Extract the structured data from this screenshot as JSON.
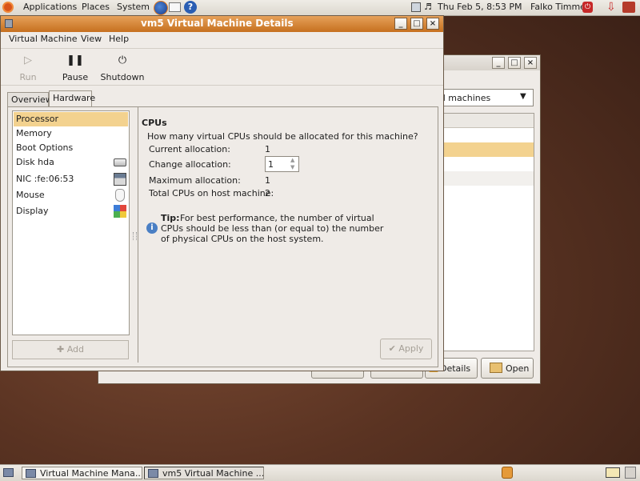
{
  "top_panel": {
    "menu": [
      "Applications",
      "Places",
      "System"
    ],
    "clock": "Thu Feb  5,  8:53 PM",
    "user": "Falko Timme"
  },
  "main_window": {
    "title": "vm5 Virtual Machine Details",
    "menu": {
      "machine": "Virtual Machine",
      "view": "View",
      "help": "Help"
    },
    "toolbar": {
      "run": "Run",
      "pause": "Pause",
      "shutdown": "Shutdown"
    },
    "tabs": [
      "Overview",
      "Hardware"
    ],
    "hardware_items": [
      {
        "label": "Processor",
        "icon": "cpu-icon"
      },
      {
        "label": "Memory",
        "icon": "memory-icon"
      },
      {
        "label": "Boot Options",
        "icon": "boot-icon"
      },
      {
        "label": "Disk hda",
        "icon": "disk-icon"
      },
      {
        "label": "NIC :fe:06:53",
        "icon": "network-icon"
      },
      {
        "label": "Mouse",
        "icon": "mouse-icon"
      },
      {
        "label": "Display",
        "icon": "display-icon"
      }
    ],
    "add_button": "Add",
    "cpu": {
      "heading": "CPUs",
      "question": "How many virtual CPUs should be allocated for this machine?",
      "current_label": "Current allocation:",
      "current_value": "1",
      "change_label": "Change allocation:",
      "change_value": "1",
      "max_label": "Maximum allocation:",
      "max_value": "1",
      "total_label": "Total CPUs on host machine:",
      "total_value": "2",
      "tip_label": "Tip:",
      "tip_line1": "For best performance, the number of virtual",
      "tip_line2": "CPUs should be less than (or equal to) the number",
      "tip_line3": "of physical CPUs on the host system."
    },
    "apply_button": "Apply"
  },
  "back_window": {
    "dropdown_value": "ual machines",
    "details_button": "Details",
    "open_button": "Open"
  },
  "taskbar": {
    "items": [
      "Virtual Machine Mana...",
      "vm5 Virtual Machine ..."
    ]
  },
  "colors": {
    "selection": "#f3d28f",
    "titlebar_active": "#d8802e",
    "desktop": "#5a3322"
  }
}
